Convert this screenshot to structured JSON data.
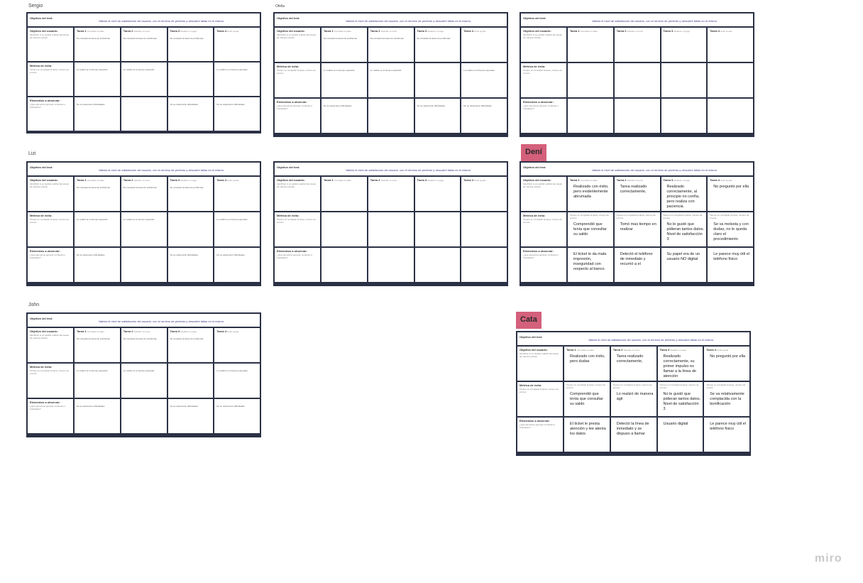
{
  "app": {
    "brand": "miro"
  },
  "labels": {
    "objective_test": "Objetivo del test:",
    "objective_text": "Validar el nivel de satisfacción del usuario, con el mínimo de pretexto y descubrir fallas en el mismo.",
    "objective_user": "Objetivo del usuario:",
    "objective_user_sub": "Identificar si es posible realizar las tareas de manera exitosa",
    "success": "Métrica de éxito:",
    "success_sub": "Tiempo en completar la tarea, número de errores",
    "observe": "Elementos a observar:",
    "observe_sub": "¿Qué elementos generan confusión o frustración?",
    "t1": "Tarea 1",
    "t1s": "Consultar el saldo",
    "t2": "Tarea 2",
    "t2s": "Solicitar un turno",
    "t3": "Tarea 3",
    "t3s": "Realizar un pago",
    "t4": "Tarea 4",
    "t4s": "Pedir ayuda"
  },
  "frames": {
    "sergio": "Sergio",
    "ofelia": "Ofelia",
    "lizi": "Lizi",
    "john": "John",
    "deni": "Dení",
    "cata": "Cata"
  },
  "notes": {
    "generic_row1": "Se completó la tarea sin problemas",
    "generic_row2": "Lo realizó en el tiempo esperado",
    "generic_row3": "No se observaron dificultades"
  },
  "deni": {
    "r1": [
      "Realizado con éxito, pero evidentemente abrumada",
      "Tarea realizado correctamente,",
      "Realizado correctamente, al principio no confía, pero realiza con paciencia",
      "No preguntó por ella"
    ],
    "r2": [
      "Comprendió que tenía que consultar su saldo",
      "Tomó mas tiempo en realizar",
      "No le gustó que pidieran tantos datos. Nivel de satisfacción 3",
      "Se va molesta y con dudas, no le queda claro el procedimiento"
    ],
    "r3": [
      "El ticket le da mala impresión, inseguridad con respecto al banco.",
      "Detectó el teléfono de inmediato y recurrió a el",
      "Su papel era de un usuario NO digital",
      "Le parece muy útil el teléfono físico"
    ]
  },
  "cata": {
    "r1": [
      "Realizado con éxito, pero dudas",
      "Tarea realizado correctamente,",
      "Realizado correctamente, su primer impulso es llamar a la línea de atención",
      "No preguntó por ella"
    ],
    "r2": [
      "Comprendió que tenía que consultar su saldo",
      "Lo realizó de manera ágil",
      "No le gustó que pidieran tantos datos. Nivel de satisfacción 3",
      "Se va relativamente complacida con la bonificación"
    ],
    "r3": [
      "El ticket le presta atención y lee atenta los datos",
      "Detectó la línea de inmediato y se dispuso a llamar",
      "Usuario digital",
      "Le parece muy útil el teléfono físico"
    ]
  }
}
